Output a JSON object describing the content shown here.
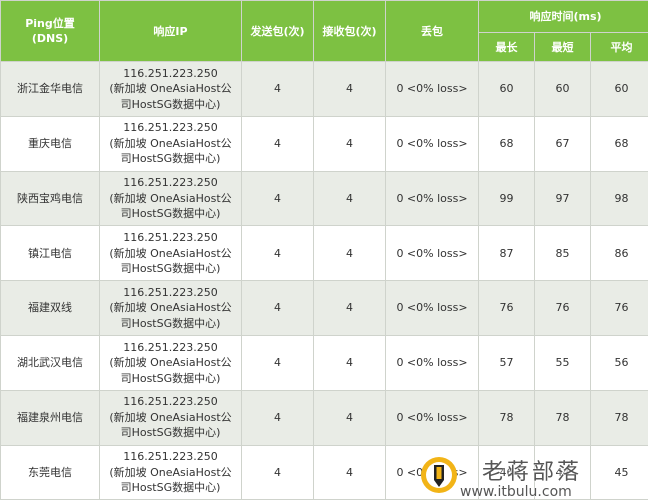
{
  "colors": {
    "header_bg": "#7dc142",
    "row_alt_bg": "#e9ece6",
    "border": "#cfd3cc"
  },
  "headers": {
    "location_line1": "Ping位置",
    "location_line2": "(DNS)",
    "ip": "响应IP",
    "sent": "发送包(次)",
    "received": "接收包(次)",
    "loss": "丢包",
    "response_time": "响应时间(ms)",
    "max": "最长",
    "min": "最短",
    "avg": "平均"
  },
  "rows": [
    {
      "location": "浙江金华电信",
      "ip_line1": "116.251.223.250",
      "ip_line2": "(新加坡 OneAsiaHost公",
      "ip_line3": "司HostSG数据中心)",
      "sent": "4",
      "received": "4",
      "loss": "0 <0% loss>",
      "max": "60",
      "min": "60",
      "avg": "60"
    },
    {
      "location": "重庆电信",
      "ip_line1": "116.251.223.250",
      "ip_line2": "(新加坡 OneAsiaHost公",
      "ip_line3": "司HostSG数据中心)",
      "sent": "4",
      "received": "4",
      "loss": "0 <0% loss>",
      "max": "68",
      "min": "67",
      "avg": "68"
    },
    {
      "location": "陕西宝鸡电信",
      "ip_line1": "116.251.223.250",
      "ip_line2": "(新加坡 OneAsiaHost公",
      "ip_line3": "司HostSG数据中心)",
      "sent": "4",
      "received": "4",
      "loss": "0 <0% loss>",
      "max": "99",
      "min": "97",
      "avg": "98"
    },
    {
      "location": "镇江电信",
      "ip_line1": "116.251.223.250",
      "ip_line2": "(新加坡 OneAsiaHost公",
      "ip_line3": "司HostSG数据中心)",
      "sent": "4",
      "received": "4",
      "loss": "0 <0% loss>",
      "max": "87",
      "min": "85",
      "avg": "86"
    },
    {
      "location": "福建双线",
      "ip_line1": "116.251.223.250",
      "ip_line2": "(新加坡 OneAsiaHost公",
      "ip_line3": "司HostSG数据中心)",
      "sent": "4",
      "received": "4",
      "loss": "0 <0% loss>",
      "max": "76",
      "min": "76",
      "avg": "76"
    },
    {
      "location": "湖北武汉电信",
      "ip_line1": "116.251.223.250",
      "ip_line2": "(新加坡 OneAsiaHost公",
      "ip_line3": "司HostSG数据中心)",
      "sent": "4",
      "received": "4",
      "loss": "0 <0% loss>",
      "max": "57",
      "min": "55",
      "avg": "56"
    },
    {
      "location": "福建泉州电信",
      "ip_line1": "116.251.223.250",
      "ip_line2": "(新加坡 OneAsiaHost公",
      "ip_line3": "司HostSG数据中心)",
      "sent": "4",
      "received": "4",
      "loss": "0 <0% loss>",
      "max": "78",
      "min": "78",
      "avg": "78"
    },
    {
      "location": "东莞电信",
      "ip_line1": "116.251.223.250",
      "ip_line2": "(新加坡 OneAsiaHost公",
      "ip_line3": "司HostSG数据中心)",
      "sent": "4",
      "received": "4",
      "loss": "0 <0% loss>",
      "max": "46",
      "min": "44",
      "avg": "45"
    }
  ],
  "watermark": {
    "title": "老蒋部落",
    "url": "www.itbulu.com",
    "logo_icon": "pencil-logo-icon"
  }
}
